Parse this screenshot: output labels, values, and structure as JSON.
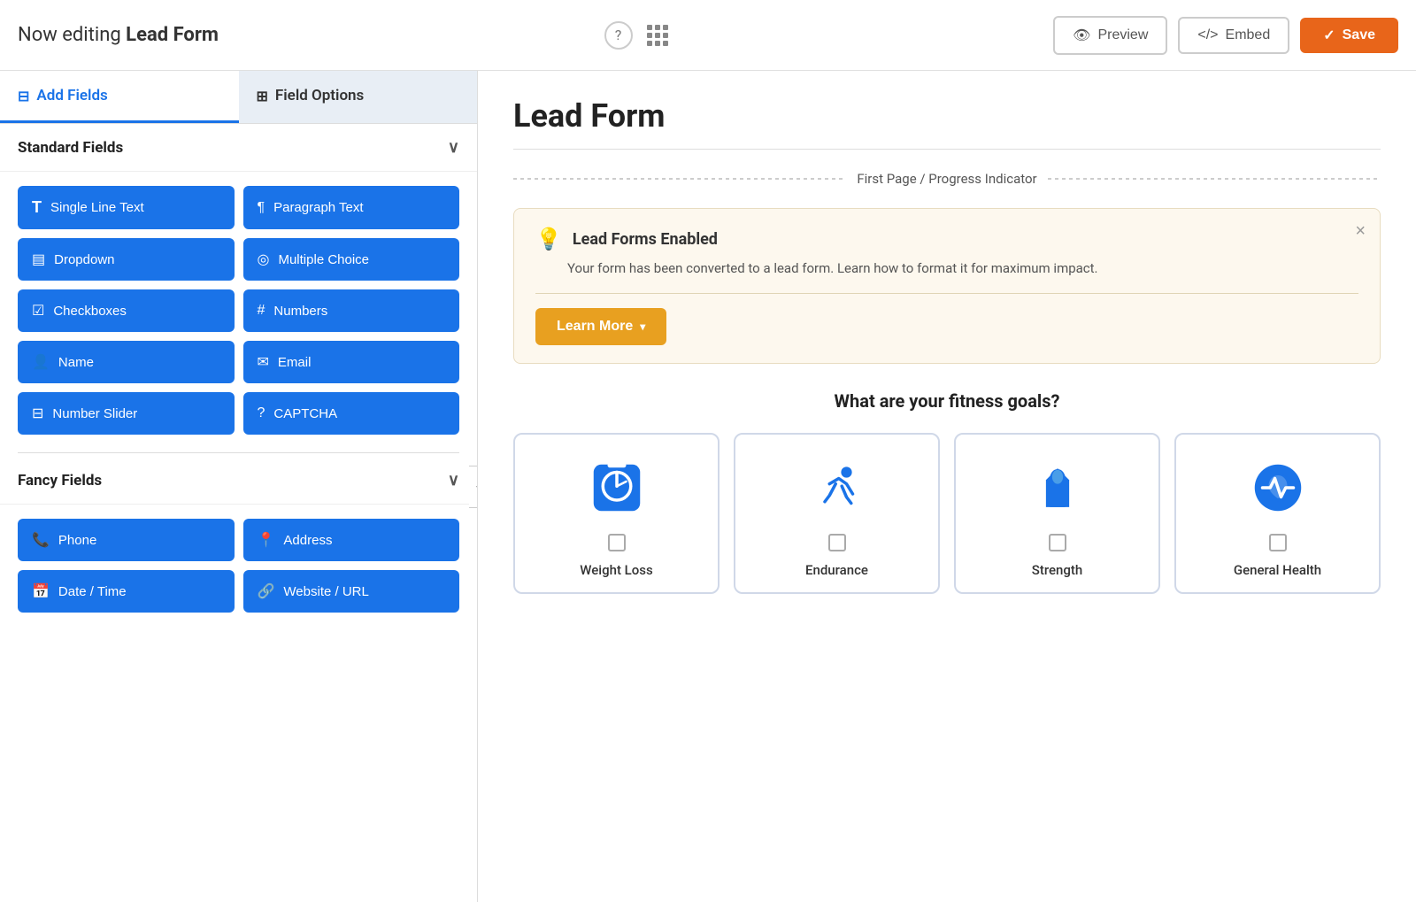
{
  "header": {
    "editing_label": "Now editing ",
    "form_name": "Lead Form",
    "preview_label": "Preview",
    "embed_label": "Embed",
    "save_label": "Save"
  },
  "sidebar": {
    "tab_add_fields": "Add Fields",
    "tab_field_options": "Field Options",
    "sections": [
      {
        "id": "standard",
        "label": "Standard Fields",
        "fields": [
          {
            "id": "single-line-text",
            "label": "Single Line Text",
            "icon": "T"
          },
          {
            "id": "paragraph-text",
            "label": "Paragraph Text",
            "icon": "¶"
          },
          {
            "id": "dropdown",
            "label": "Dropdown",
            "icon": "▤"
          },
          {
            "id": "multiple-choice",
            "label": "Multiple Choice",
            "icon": "⊙"
          },
          {
            "id": "checkboxes",
            "label": "Checkboxes",
            "icon": "☑"
          },
          {
            "id": "numbers",
            "label": "Numbers",
            "icon": "#"
          },
          {
            "id": "name",
            "label": "Name",
            "icon": "👤"
          },
          {
            "id": "email",
            "label": "Email",
            "icon": "✉"
          },
          {
            "id": "number-slider",
            "label": "Number Slider",
            "icon": "⊟"
          },
          {
            "id": "captcha",
            "label": "CAPTCHA",
            "icon": "?"
          }
        ]
      },
      {
        "id": "fancy",
        "label": "Fancy Fields",
        "fields": [
          {
            "id": "phone",
            "label": "Phone",
            "icon": "📞"
          },
          {
            "id": "address",
            "label": "Address",
            "icon": "📍"
          },
          {
            "id": "date-time",
            "label": "Date / Time",
            "icon": "📅"
          },
          {
            "id": "website-url",
            "label": "Website / URL",
            "icon": "🔗"
          }
        ]
      }
    ]
  },
  "content": {
    "form_title": "Lead Form",
    "progress_indicator": "First Page / Progress Indicator",
    "banner": {
      "title": "Lead Forms Enabled",
      "text": "Your form has been converted to a lead form. Learn how to format it for maximum impact.",
      "learn_more_label": "Learn More"
    },
    "fitness": {
      "question": "What are your fitness goals?",
      "options": [
        {
          "id": "weight-loss",
          "label": "Weight Loss"
        },
        {
          "id": "endurance",
          "label": "Endurance"
        },
        {
          "id": "strength",
          "label": "Strength"
        },
        {
          "id": "general-health",
          "label": "General Health"
        }
      ]
    }
  },
  "colors": {
    "blue": "#1a73e8",
    "orange": "#e8651a",
    "amber": "#e8a020",
    "fitness_blue": "#1a73e8"
  }
}
